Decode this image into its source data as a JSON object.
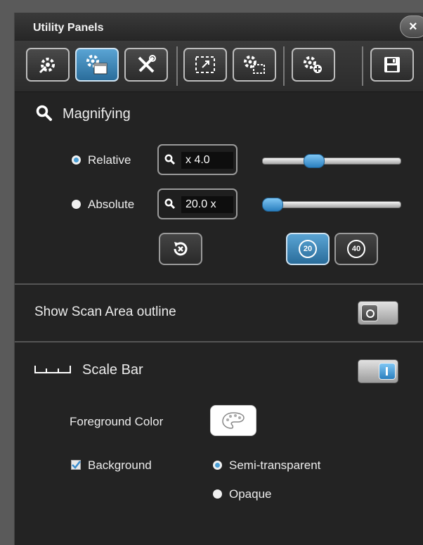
{
  "window": {
    "title": "Utility Panels",
    "close_glyph": "×"
  },
  "toolbar": {
    "buttons": [
      {
        "icon": "magic-gear-icon",
        "active": false
      },
      {
        "icon": "gear-window-icon",
        "active": true
      },
      {
        "icon": "tools-icon",
        "active": false
      },
      {
        "icon": "expand-frame-icon",
        "active": false
      },
      {
        "icon": "gear-frame-icon",
        "active": false
      },
      {
        "icon": "gear-add-icon",
        "active": false
      },
      {
        "icon": "save-icon",
        "active": false
      }
    ]
  },
  "magnifying": {
    "title": "Magnifying",
    "mode_selected": "Relative",
    "relative": {
      "label": "Relative",
      "value": "x 4.0",
      "slider_fraction": 0.35
    },
    "absolute": {
      "label": "Absolute",
      "value": "20.0 x",
      "slider_fraction": 0.0
    },
    "reset_icon": "reset-zoom-icon",
    "zoom_presets": [
      {
        "label": "20",
        "active": true
      },
      {
        "label": "40",
        "active": false
      }
    ]
  },
  "scan_area": {
    "label": "Show Scan Area outline",
    "enabled": false
  },
  "scale_bar": {
    "label": "Scale Bar",
    "enabled": true,
    "foreground_label": "Foreground Color",
    "background_label": "Background",
    "background_checked": true,
    "options": [
      {
        "label": "Semi-transparent",
        "selected": true
      },
      {
        "label": "Opaque",
        "selected": false
      }
    ]
  },
  "colors": {
    "accent": "#3a8ccc",
    "panel": "#232323"
  }
}
